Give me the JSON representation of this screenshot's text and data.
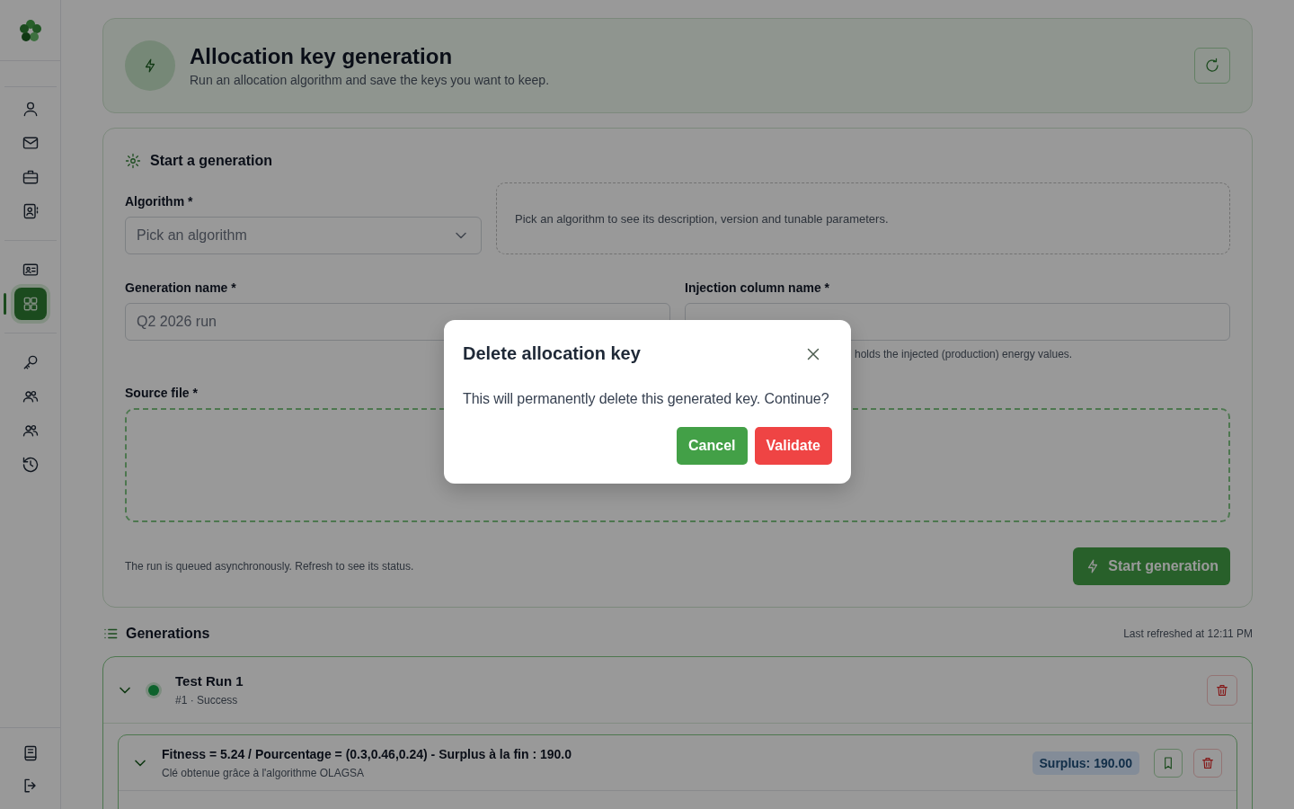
{
  "sidebar": {
    "items": [
      {
        "selected": false
      },
      {
        "selected": false
      },
      {
        "selected": false
      },
      {
        "selected": false
      },
      {
        "selected": false
      },
      {
        "selected": true
      },
      {
        "selected": false
      },
      {
        "selected": false
      },
      {
        "selected": false
      },
      {
        "selected": false
      }
    ],
    "bottom_items": [
      {
        "selected": false
      },
      {
        "selected": false
      }
    ]
  },
  "header": {
    "title": "Allocation key generation",
    "subtitle": "Run an allocation algorithm and save the keys you want to keep."
  },
  "form": {
    "title": "Start a generation",
    "algorithm": {
      "label": "Algorithm *",
      "placeholder": "Pick an algorithm"
    },
    "algorithm_info": "Pick an algorithm to see its description, version and tunable parameters.",
    "generation_name": {
      "label": "Generation name *",
      "placeholder": "Q2 2026 run"
    },
    "injection_column": {
      "label": "Injection column name *",
      "hint": "holds the injected (production) energy values."
    },
    "source_file": {
      "label": "Source file *"
    },
    "note": "The run is queued asynchronously. Refresh to see its status.",
    "submit": "Start generation"
  },
  "generations": {
    "title": "Generations",
    "last_refreshed": "Last refreshed at 12:11 PM",
    "items": [
      {
        "name": "Test Run 1",
        "meta": "#1 · Success",
        "expanded": true,
        "keys": [
          {
            "title": "Fitness = 5.24 / Pourcentage = (0.3,0.46,0.24) - Surplus à la fin : 190.0",
            "subtitle": "Clé obtenue grâce à l'algorithme OLAGSA",
            "badge": "Surplus: 190.00",
            "expanded": true
          }
        ]
      }
    ]
  },
  "dialog": {
    "title": "Delete allocation key",
    "message": "This will permanently delete this generated key. Continue?",
    "buttons": [
      {
        "label": "Cancel",
        "kind": "cancel"
      },
      {
        "label": "Validate",
        "kind": "confirm"
      }
    ]
  }
}
